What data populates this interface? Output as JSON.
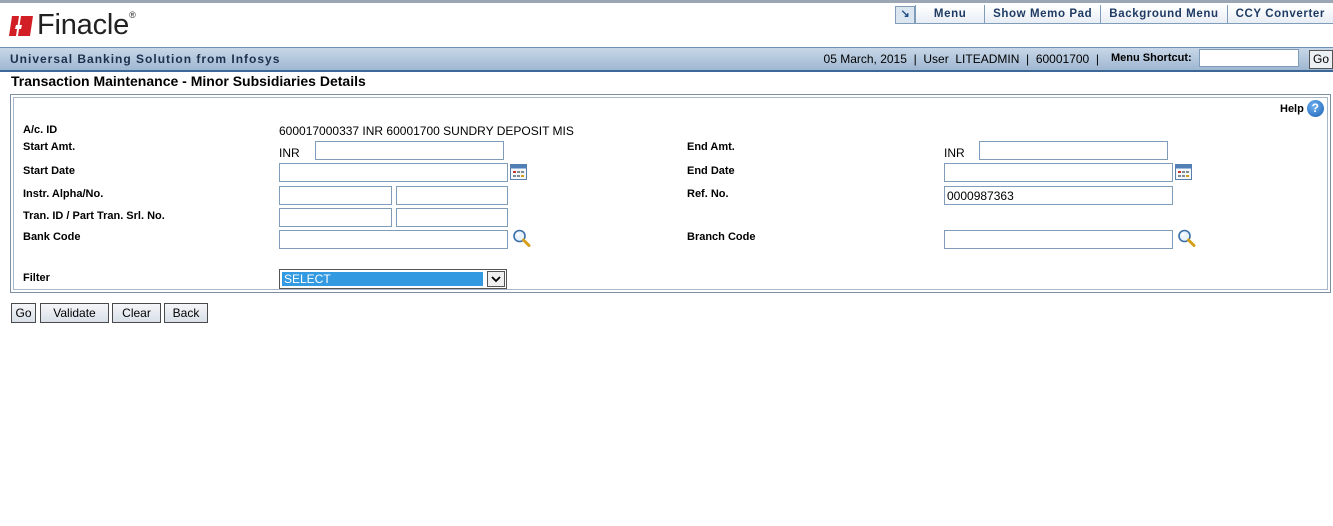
{
  "header": {
    "logo_text": "Finacle",
    "logo_reg": "®",
    "tagline": "Universal Banking Solution from Infosys",
    "menu": {
      "arrow": "↘",
      "items": [
        "Menu",
        "Show Memo Pad",
        "Background Menu",
        "CCY Converter"
      ]
    },
    "status": "05 March, 2015  |  User  LITEADMIN  |  60001700  |",
    "shortcut_label": "Menu Shortcut:",
    "shortcut_value": "",
    "shortcut_go": "Go"
  },
  "page": {
    "title": "Transaction Maintenance - Minor Subsidiaries Details",
    "help": "Help",
    "help_icon": "?"
  },
  "form": {
    "ac_id_label": "A/c. ID",
    "ac_id_value": "600017000337 INR 60001700 SUNDRY DEPOSIT MIS",
    "start_amt_label": "Start Amt.",
    "start_amt_currency": "INR",
    "start_amt_value": "",
    "end_amt_label": "End Amt.",
    "end_amt_currency": "INR",
    "end_amt_value": "",
    "start_date_label": "Start Date",
    "start_date_value": "",
    "end_date_label": "End Date",
    "end_date_value": "",
    "instr_label": "Instr. Alpha/No.",
    "instr_alpha_value": "",
    "instr_no_value": "",
    "ref_no_label": "Ref. No.",
    "ref_no_value": "0000987363",
    "tran_label": "Tran. ID / Part Tran. Srl. No.",
    "tran_id_value": "",
    "part_tran_value": "",
    "bank_code_label": "Bank Code",
    "bank_code_value": "",
    "branch_code_label": "Branch Code",
    "branch_code_value": "",
    "filter_label": "Filter",
    "filter_selected": "SELECT"
  },
  "buttons": {
    "go": "Go",
    "validate": "Validate",
    "clear": "Clear",
    "back": "Back"
  },
  "colors": {
    "brand_red": "#d21f26",
    "header_blue": "#9fb7d2",
    "select_highlight": "#3399e0"
  }
}
